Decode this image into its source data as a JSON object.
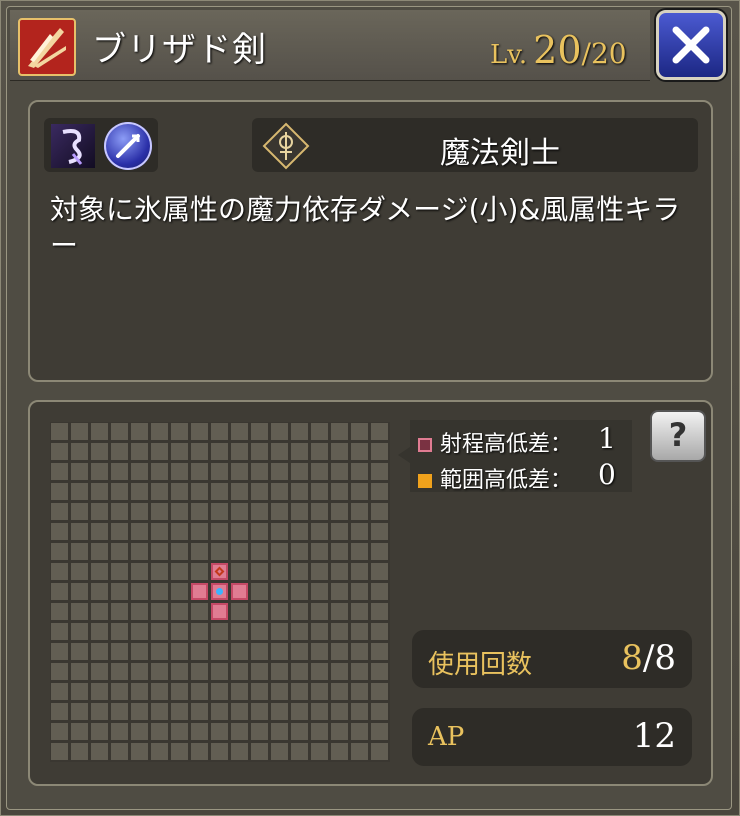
{
  "header": {
    "title": "ブリザド剣",
    "level_label": "Lv.",
    "level_current": "20",
    "level_separator": "/",
    "level_max": "20"
  },
  "description": {
    "job_name": "魔法剣士",
    "text": "対象に氷属性の魔力依存ダメージ(小)&風属性キラー"
  },
  "range": {
    "grid_cols": 17,
    "grid_rows": 17,
    "range_height_label": "射程高低差：",
    "range_height_value": "1",
    "area_height_label": "範囲高低差：",
    "area_height_value": "0",
    "help_label": "?"
  },
  "stats": {
    "uses_label": "使用回数",
    "uses_current": "8",
    "uses_separator": "/",
    "uses_max": "8",
    "ap_label": "AP",
    "ap_value": "12"
  },
  "colors": {
    "gold": "#e9c25e",
    "range_square": "#e07c92",
    "area_square": "#f0a21c",
    "close_button": "#2f3bb0"
  },
  "icons": {
    "skill": "sword-slash-icon",
    "element1": "dark-element-icon",
    "element2": "ice-magic-icon",
    "job": "magic-swordsman-icon",
    "close": "close-icon",
    "help": "help-icon"
  }
}
